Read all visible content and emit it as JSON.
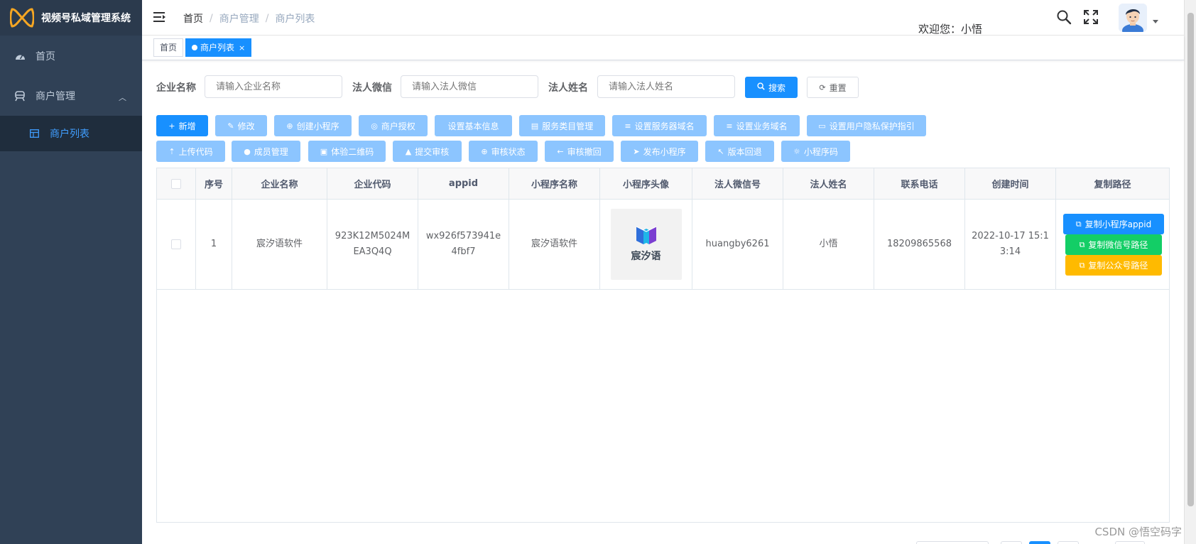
{
  "app": {
    "title": "视频号私域管理系统"
  },
  "sidebar": {
    "items": [
      {
        "label": "首页",
        "icon": "dashboard-icon"
      },
      {
        "label": "商户管理",
        "icon": "merchant-icon",
        "expanded": true,
        "children": [
          {
            "label": "商户列表",
            "icon": "list-icon",
            "active": true
          }
        ]
      }
    ]
  },
  "header": {
    "breadcrumb": [
      "首页",
      "商户管理",
      "商户列表"
    ],
    "welcome": "欢迎您：小悟"
  },
  "tags": [
    {
      "label": "首页",
      "active": false
    },
    {
      "label": "商户列表",
      "active": true,
      "close": "×"
    }
  ],
  "search": {
    "fields": [
      {
        "label": "企业名称",
        "placeholder": "请输入企业名称"
      },
      {
        "label": "法人微信",
        "placeholder": "请输入法人微信"
      },
      {
        "label": "法人姓名",
        "placeholder": "请输入法人姓名"
      }
    ],
    "search_label": "搜索",
    "reset_label": "重置"
  },
  "toolbar": {
    "row1": [
      {
        "label": "新增",
        "icon": "+",
        "state": "enabled"
      },
      {
        "label": "修改",
        "icon": "✎",
        "state": "disabled"
      },
      {
        "label": "创建小程序",
        "icon": "⊕",
        "state": "disabled"
      },
      {
        "label": "商户授权",
        "icon": "◎",
        "state": "disabled"
      },
      {
        "label": "设置基本信息",
        "icon": "",
        "state": "disabled"
      },
      {
        "label": "服务类目管理",
        "icon": "▤",
        "state": "disabled"
      },
      {
        "label": "设置服务器域名",
        "icon": "≡",
        "state": "disabled"
      },
      {
        "label": "设置业务域名",
        "icon": "≡",
        "state": "disabled"
      },
      {
        "label": "设置用户隐私保护指引",
        "icon": "▭",
        "state": "disabled"
      }
    ],
    "row2": [
      {
        "label": "上传代码",
        "icon": "⇡",
        "state": "disabled"
      },
      {
        "label": "成员管理",
        "icon": "●",
        "state": "disabled"
      },
      {
        "label": "体验二维码",
        "icon": "▣",
        "state": "disabled"
      },
      {
        "label": "提交审核",
        "icon": "▲",
        "state": "disabled"
      },
      {
        "label": "审核状态",
        "icon": "⊕",
        "state": "disabled"
      },
      {
        "label": "审核撤回",
        "icon": "←",
        "state": "disabled"
      },
      {
        "label": "发布小程序",
        "icon": "➤",
        "state": "disabled"
      },
      {
        "label": "版本回退",
        "icon": "↖",
        "state": "disabled"
      },
      {
        "label": "小程序码",
        "icon": "☼",
        "state": "disabled"
      }
    ]
  },
  "table": {
    "columns": [
      "",
      "序号",
      "企业名称",
      "企业代码",
      "appid",
      "小程序名称",
      "小程序头像",
      "法人微信号",
      "法人姓名",
      "联系电话",
      "创建时间",
      "复制路径"
    ],
    "rows": [
      {
        "index": "1",
        "company_name": "宸汐语软件",
        "company_code": "923K12M5024MEA3Q4Q",
        "appid": "wx926f573941e4fbf7",
        "mini_program_name": "宸汐语软件",
        "avatar_text": "宸汐语",
        "legal_wechat": "huangby6261",
        "legal_name": "小悟",
        "phone": "18209865568",
        "created_at": "2022-10-17 15:13:14",
        "actions": [
          "复制小程序appid",
          "复制微信号路径",
          "复制公众号路径"
        ]
      }
    ]
  },
  "colors": {
    "sidebar_bg": "#304156",
    "sidebar_active_bg": "#1f2d3d",
    "primary": "#1890ff",
    "primary_disabled": "#8cc5ff",
    "success": "#13ce66",
    "warning": "#ffba00"
  },
  "watermark": "CSDN @悟空码字"
}
